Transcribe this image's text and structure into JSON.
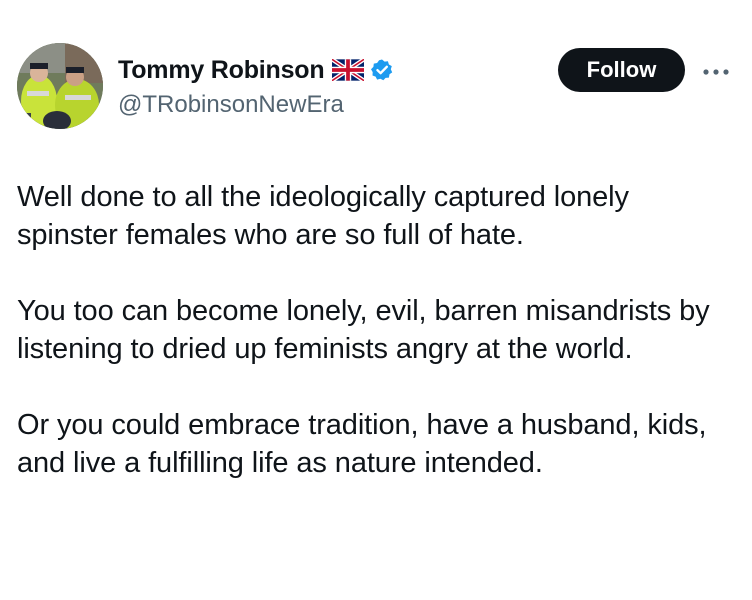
{
  "author": {
    "display_name": "Tommy Robinson",
    "handle": "@TRobinsonNewEra",
    "flag_icon": "uk-flag-icon",
    "verified_icon": "verified-badge-icon",
    "verified_color": "#1d9bf0"
  },
  "actions": {
    "follow_label": "Follow",
    "more_icon": "more-options-icon"
  },
  "tweet": {
    "paragraphs": [
      "Well done to all the ideologically captured lonely spinster females who are so full of hate.",
      "You too can become lonely, evil, barren misandrists by listening to dried up feminists angry at the world.",
      "Or you could embrace tradition, have a husband, kids, and live a fulfilling life as nature intended."
    ]
  },
  "colors": {
    "text": "#0f1419",
    "secondary_text": "#536471",
    "follow_bg": "#0f1419",
    "follow_text": "#ffffff"
  }
}
